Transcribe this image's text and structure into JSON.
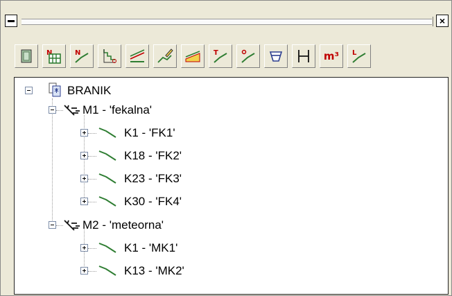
{
  "window": {
    "close_glyph": "×"
  },
  "toolbar": {
    "buttons": [
      {
        "name": "layer-icon"
      },
      {
        "name": "grid-n-icon"
      },
      {
        "name": "n-line-icon"
      },
      {
        "name": "profile-steps-icon"
      },
      {
        "name": "longitudinal-section-icon"
      },
      {
        "name": "edit-profile-icon"
      },
      {
        "name": "fill-profile-icon"
      },
      {
        "name": "t-line-icon"
      },
      {
        "name": "point-line-icon"
      },
      {
        "name": "manhole-icon"
      },
      {
        "name": "dimension-icon"
      },
      {
        "name": "cubic-meter-icon",
        "text": "m³"
      },
      {
        "name": "l-line-icon"
      }
    ]
  },
  "tree": {
    "root": {
      "label": "BRANIK"
    },
    "networks": [
      {
        "label": "M1 - 'fekalna'",
        "channels": [
          "K1 - 'FK1'",
          "K18 - 'FK2'",
          "K23 - 'FK3'",
          "K30 - 'FK4'"
        ]
      },
      {
        "label": "M2 - 'meteorna'",
        "channels": [
          "K1 - 'MK1'",
          "K13 - 'MK2'"
        ]
      }
    ]
  },
  "colors": {
    "channel_icon": "#2e7d32",
    "window_bg": "#ece9d8"
  }
}
